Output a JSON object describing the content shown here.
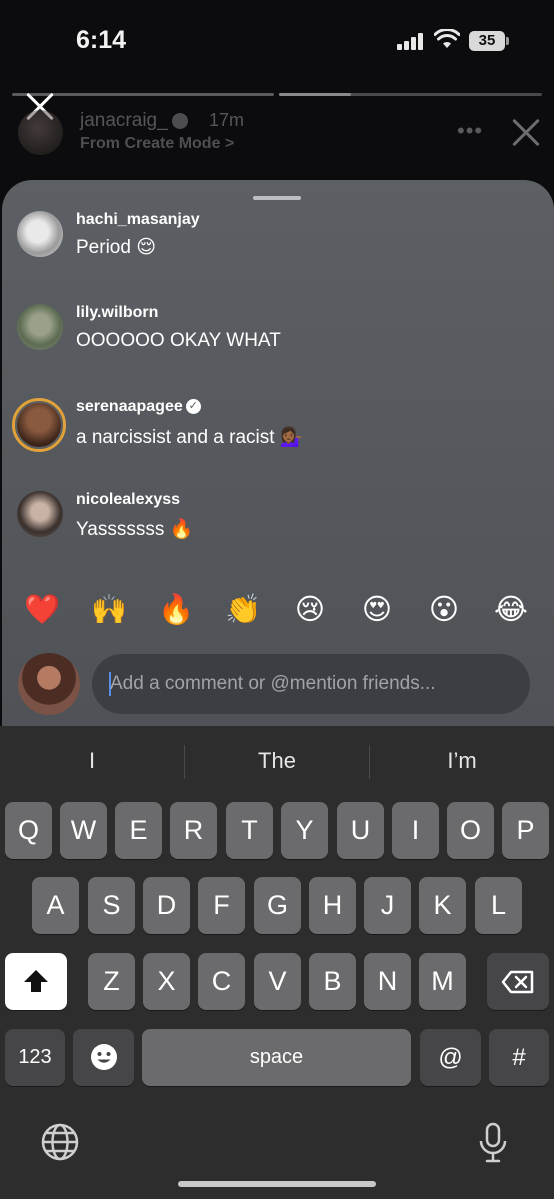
{
  "status": {
    "time": "6:14",
    "battery": "35"
  },
  "story": {
    "username": "janacraig_",
    "time_ago": "17m",
    "subtitle": "From Create Mode >",
    "more": "•••",
    "progress_fraction": 0.27
  },
  "comments": [
    {
      "user": "hachi_masanjay",
      "text": "Period 😌",
      "verified": false
    },
    {
      "user": "lily.wilborn",
      "text": "OOOOOO OKAY WHAT",
      "verified": false
    },
    {
      "user": "serenaapagee",
      "text": "a narcissist and a racist 💁🏾‍♀️",
      "verified": true
    },
    {
      "user": "nicolealexyss",
      "text": "Yasssssss 🔥",
      "verified": false
    }
  ],
  "quick_reactions": [
    "❤️",
    "🙌",
    "🔥",
    "👏",
    "😢",
    "😍",
    "😮",
    "😂"
  ],
  "composer": {
    "placeholder": "Add a comment or @mention friends..."
  },
  "keyboard": {
    "suggestions": [
      "I",
      "The",
      "I’m"
    ],
    "row1": [
      "Q",
      "W",
      "E",
      "R",
      "T",
      "Y",
      "U",
      "I",
      "O",
      "P"
    ],
    "row2": [
      "A",
      "S",
      "D",
      "F",
      "G",
      "H",
      "J",
      "K",
      "L"
    ],
    "row3": [
      "Z",
      "X",
      "C",
      "V",
      "B",
      "N",
      "M"
    ],
    "numbers": "123",
    "space": "space",
    "at": "@",
    "hash": "#"
  },
  "colors": {
    "sheet": "#5c5f63",
    "keyboard": "#2d2d2e",
    "key": "#6b6b6d",
    "caret": "#5b8ee8"
  }
}
